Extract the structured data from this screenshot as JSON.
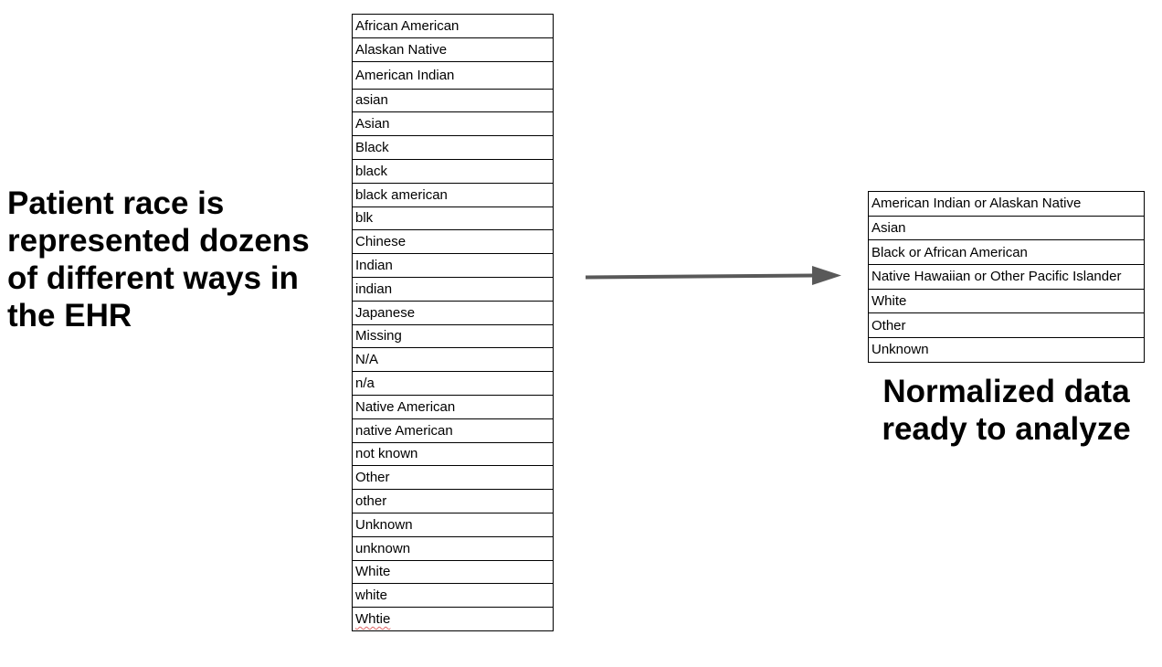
{
  "left_heading": "Patient race is represented dozens of different ways in the EHR",
  "raw_values": [
    "African American",
    "Alaskan Native",
    "American Indian",
    "asian",
    "Asian",
    "Black",
    "black",
    "black american",
    "blk",
    "Chinese",
    "Indian",
    "indian",
    "Japanese",
    "Missing",
    "N/A",
    "n/a",
    "Native American",
    "native American",
    "not known",
    "Other",
    "other",
    "Unknown",
    "unknown",
    "White",
    "white",
    "Whtie"
  ],
  "arrow": {
    "icon": "right-arrow-icon",
    "color": "#595959"
  },
  "normalized_values": [
    "American Indian or Alaskan Native",
    "Asian",
    "Black or African American",
    "Native Hawaiian or Other Pacific Islander",
    "White",
    "Other",
    "Unknown"
  ],
  "right_caption": "Normalized data ready to analyze"
}
